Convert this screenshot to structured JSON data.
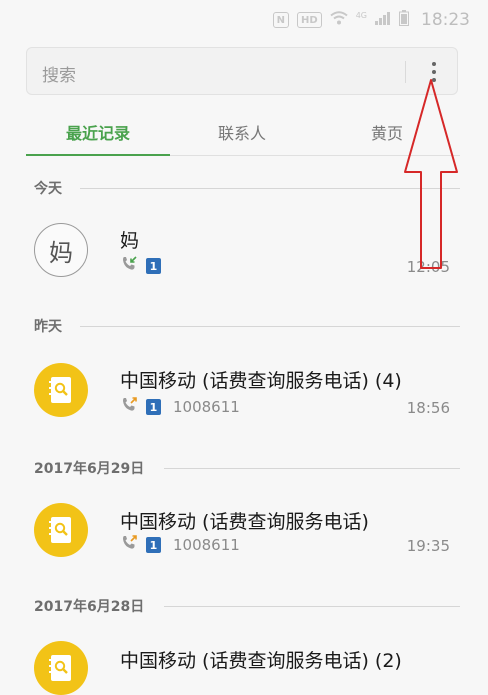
{
  "status_bar": {
    "nfc": "N",
    "hd": "HD",
    "network": "4G",
    "time": "18:23",
    "icons": [
      "nfc-icon",
      "hd-icon",
      "wifi-icon",
      "signal-icon",
      "battery-icon"
    ]
  },
  "search": {
    "placeholder": "搜索",
    "menu_icon": "more-vertical-icon"
  },
  "tabs": [
    {
      "label": "最近记录",
      "active": true
    },
    {
      "label": "联系人",
      "active": false
    },
    {
      "label": "黄页",
      "active": false
    }
  ],
  "colors": {
    "accent": "#4aa24d",
    "avatar_yellow": "#f2c317",
    "sim_badge": "#2f6fb8",
    "annotation_arrow": "#d62828"
  },
  "sections": [
    {
      "label": "今天",
      "entries": [
        {
          "name": "妈",
          "avatar_char": "妈",
          "avatar": "letter",
          "call_type": "incoming-call-icon",
          "sim": "1",
          "number": "",
          "time": "12:05"
        }
      ]
    },
    {
      "label": "昨天",
      "entries": [
        {
          "name": "中国移动 (话费查询服务电话) (4)",
          "avatar": "yellow-page-icon",
          "call_type": "outgoing-call-icon",
          "sim": "1",
          "number": "1008611",
          "time": "18:56"
        }
      ]
    },
    {
      "label": "2017年6月29日",
      "entries": [
        {
          "name": "中国移动 (话费查询服务电话)",
          "avatar": "yellow-page-icon",
          "call_type": "outgoing-call-icon",
          "sim": "1",
          "number": "1008611",
          "time": "19:35"
        }
      ]
    },
    {
      "label": "2017年6月28日",
      "entries": [
        {
          "name": "中国移动 (话费查询服务电话) (2)",
          "avatar": "yellow-page-icon",
          "call_type": "",
          "sim": "",
          "number": "",
          "time": ""
        }
      ]
    }
  ]
}
